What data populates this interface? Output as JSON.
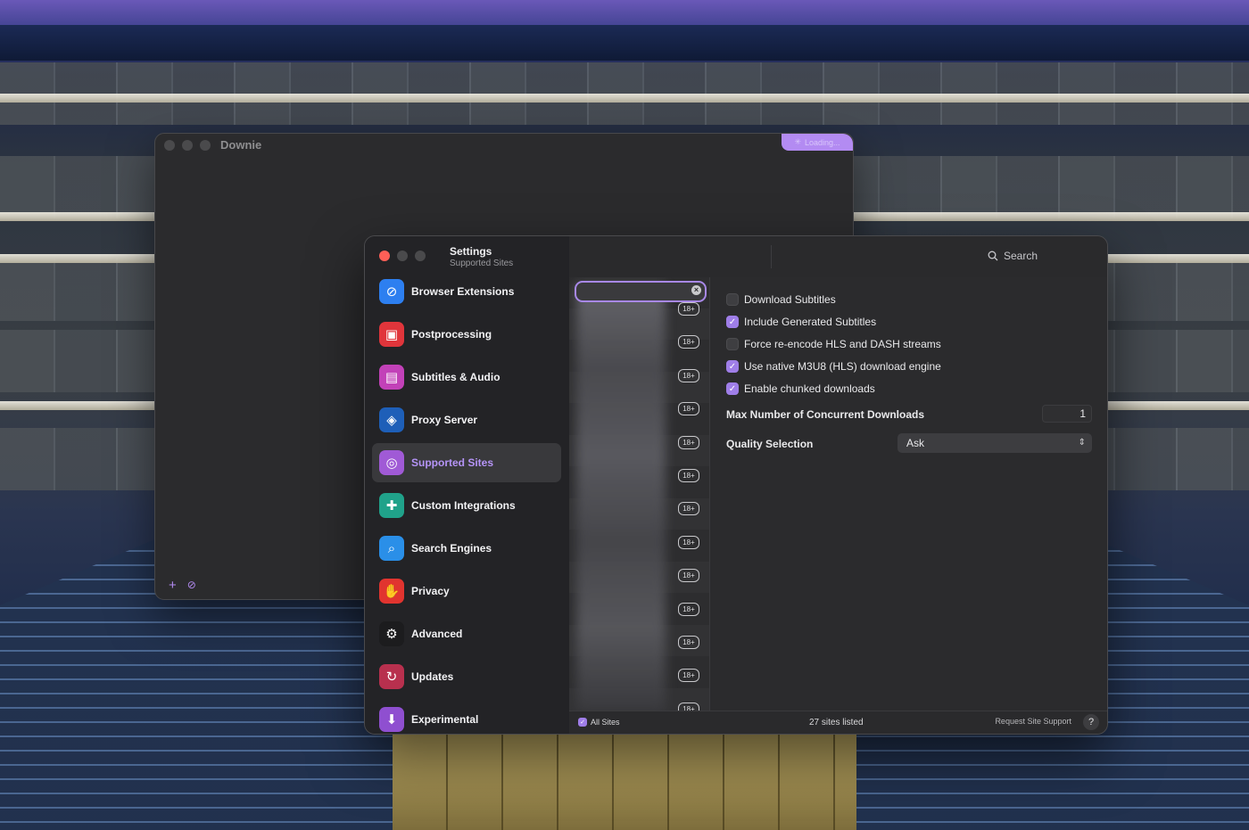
{
  "downie": {
    "title": "Downie",
    "loading": "Loading..."
  },
  "settings": {
    "title": "Settings",
    "subtitle": "Supported Sites",
    "search_label": "Search"
  },
  "sidebar": {
    "items": [
      {
        "label": "Browser Extensions",
        "icon": "compass-icon",
        "color": "#2d7ff0"
      },
      {
        "label": "Postprocessing",
        "icon": "chip-icon",
        "color": "#e0353b"
      },
      {
        "label": "Subtitles & Audio",
        "icon": "speech-bubble-icon",
        "color": "#c241b8"
      },
      {
        "label": "Proxy Server",
        "icon": "shield-icon",
        "color": "#1e5fb8"
      },
      {
        "label": "Supported Sites",
        "icon": "globe-icon",
        "color": "#a05ad6"
      },
      {
        "label": "Custom Integrations",
        "icon": "puzzle-icon",
        "color": "#20a28a"
      },
      {
        "label": "Search Engines",
        "icon": "magnifier-icon",
        "color": "#2a8fe8"
      },
      {
        "label": "Privacy",
        "icon": "hand-icon",
        "color": "#e1342f"
      },
      {
        "label": "Advanced",
        "icon": "gear-icon",
        "color": "#1c1c1e"
      },
      {
        "label": "Updates",
        "icon": "refresh-icon",
        "color": "#b8304e"
      },
      {
        "label": "Experimental",
        "icon": "flask-icon",
        "color": "#8f4fd0"
      }
    ],
    "active": "Supported Sites"
  },
  "sites_list": {
    "badge": "18+",
    "badge_count": 13
  },
  "options": [
    {
      "label": "Download Subtitles",
      "checked": false
    },
    {
      "label": "Include Generated Subtitles",
      "checked": true
    },
    {
      "label": "Force re-encode HLS and DASH streams",
      "checked": false
    },
    {
      "label": "Use native M3U8 (HLS) download engine",
      "checked": true
    },
    {
      "label": "Enable chunked downloads",
      "checked": true
    }
  ],
  "concurrent": {
    "label": "Max Number of Concurrent Downloads",
    "value": "1"
  },
  "quality": {
    "label": "Quality Selection",
    "value": "Ask"
  },
  "bottombar": {
    "all_sites": "All Sites",
    "count": "27 sites listed",
    "request": "Request Site Support",
    "help": "?"
  },
  "colors": {
    "accent": "#b594f7",
    "checkbox_on": "#9f7ee8"
  }
}
